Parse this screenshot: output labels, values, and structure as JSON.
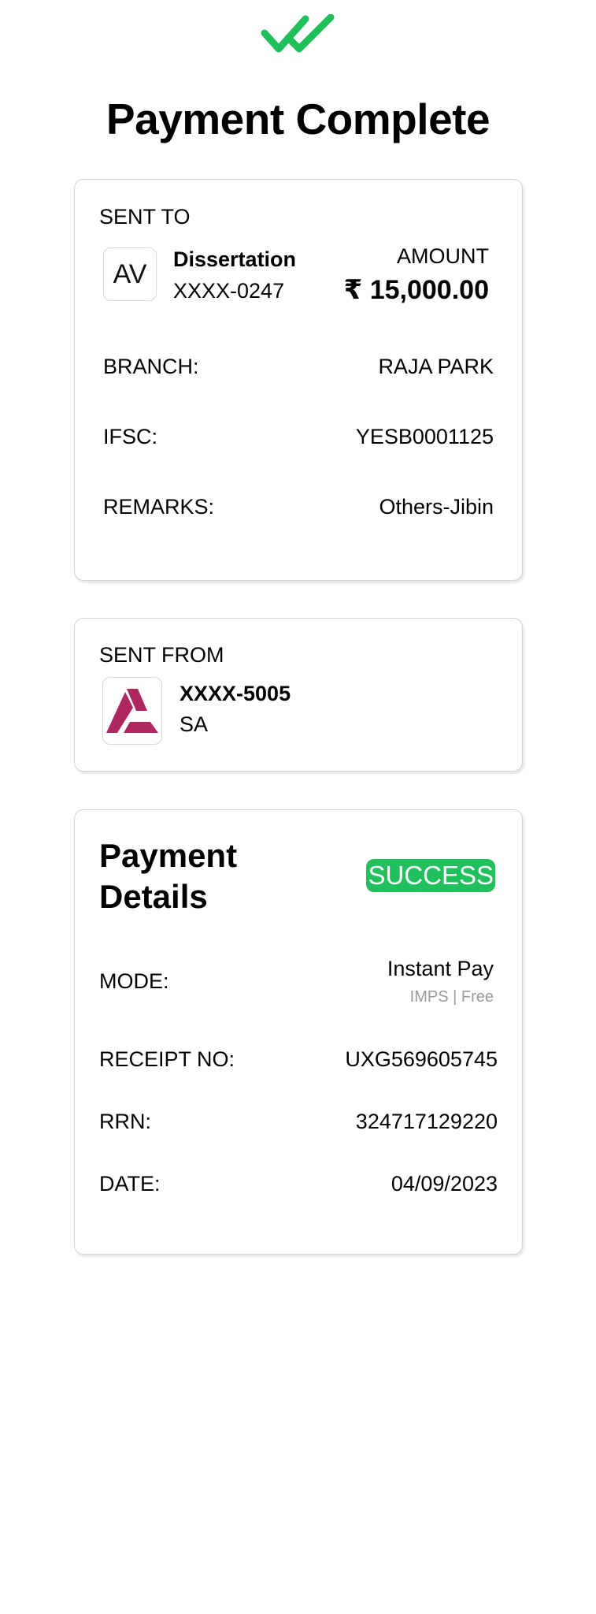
{
  "header": {
    "title": "Payment Complete",
    "icon": "double-check-icon",
    "icon_color": "#1fbf5a"
  },
  "sent_to": {
    "heading": "SENT TO",
    "avatar_initials": "AV",
    "name": "Dissertation",
    "account": "XXXX-0247",
    "amount_label": "AMOUNT",
    "amount": "₹ 15,000.00",
    "rows": [
      {
        "label": "BRANCH:",
        "value": "RAJA PARK"
      },
      {
        "label": "IFSC:",
        "value": "YESB0001125"
      },
      {
        "label": "REMARKS:",
        "value": "Others-Jibin"
      }
    ]
  },
  "sent_from": {
    "heading": "SENT FROM",
    "bank_logo": "axis-bank-logo",
    "bank_logo_color": "#ae275f",
    "account": "XXXX-5005",
    "account_type": "SA"
  },
  "payment_details": {
    "title_line1": "Payment",
    "title_line2": "Details",
    "status": "SUCCESS",
    "status_color": "#20c05c",
    "mode_label": "MODE:",
    "mode_value": "Instant Pay",
    "mode_sub": "IMPS | Free",
    "rows": [
      {
        "label": "RECEIPT NO:",
        "value": "UXG569605745"
      },
      {
        "label": "RRN:",
        "value": "324717129220"
      },
      {
        "label": "DATE:",
        "value": "04/09/2023"
      }
    ]
  }
}
